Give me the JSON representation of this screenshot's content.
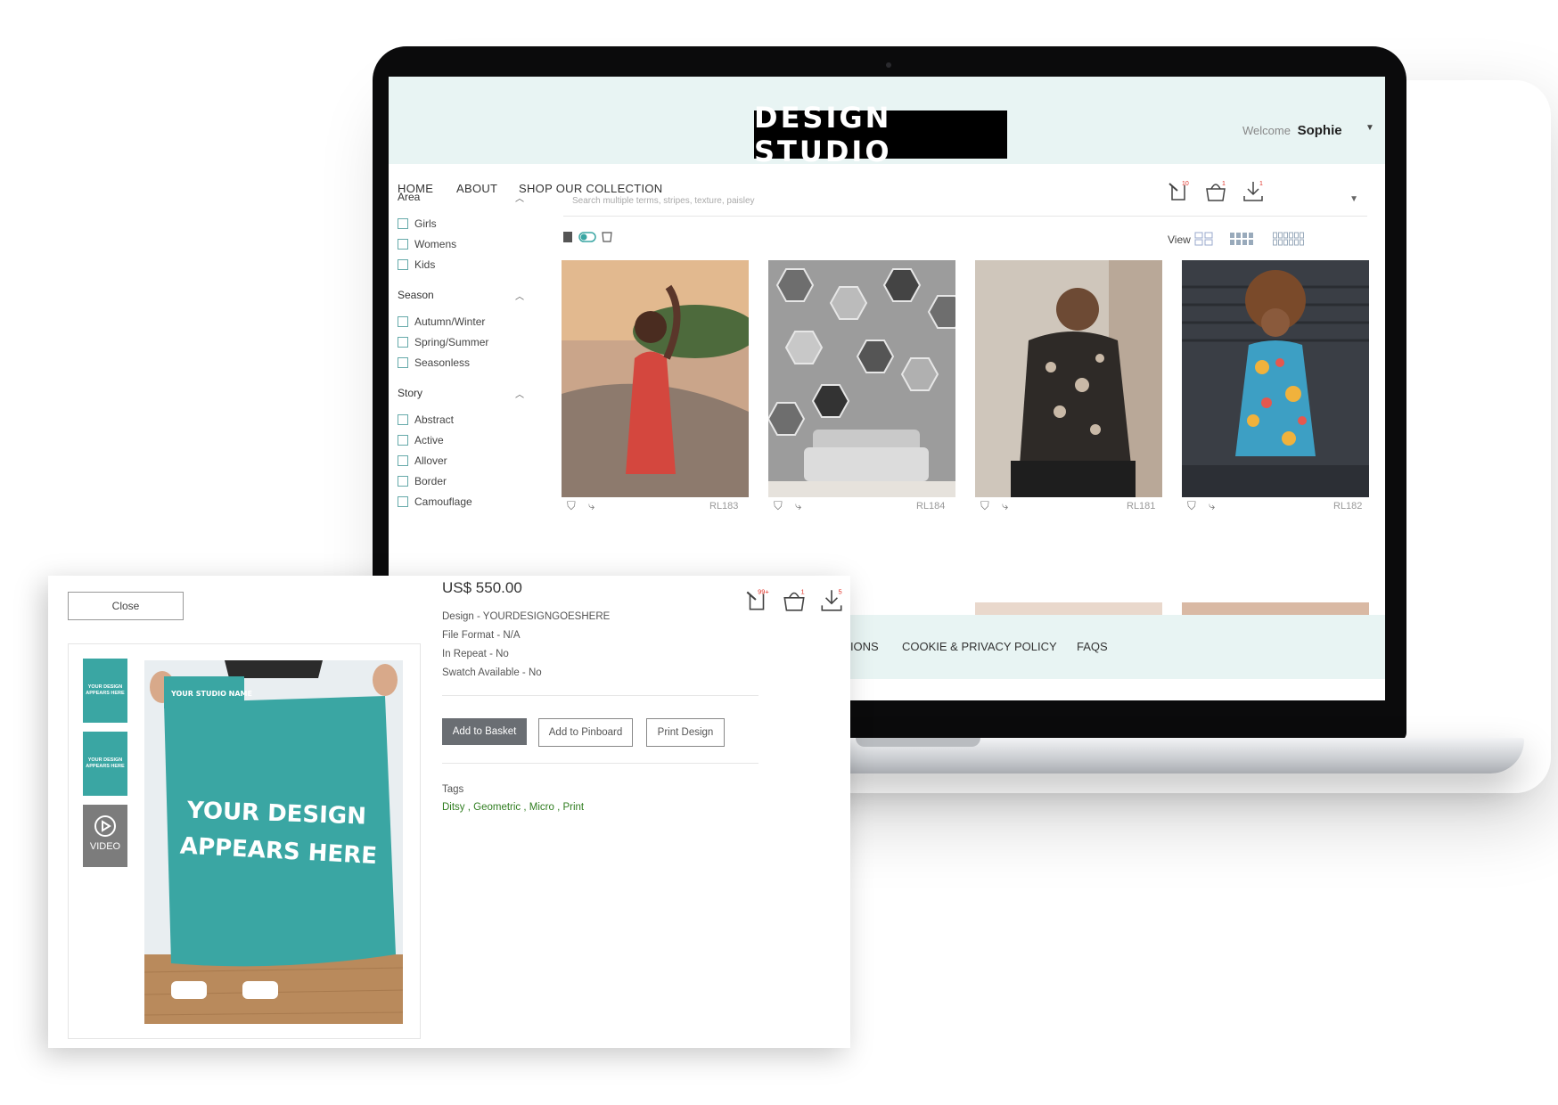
{
  "site": {
    "logo": "DESIGN STUDIO",
    "welcome_prefix": "Welcome",
    "user_name": "Sophie",
    "nav": [
      "HOME",
      "ABOUT",
      "SHOP OUR COLLECTION"
    ],
    "pinboard_badge": "10",
    "basket_badge": "1",
    "download_badge": "1",
    "search_placeholder": "Search multiple terms, stripes, texture, paisley",
    "view_label": "View",
    "filters": [
      {
        "title": "Area",
        "options": [
          "Girls",
          "Womens",
          "Kids"
        ]
      },
      {
        "title": "Season",
        "options": [
          "Autumn/Winter",
          "Spring/Summer",
          "Seasonless"
        ]
      },
      {
        "title": "Story",
        "options": [
          "Abstract",
          "Active",
          "Allover",
          "Border",
          "Camouflage"
        ]
      }
    ],
    "products": [
      {
        "code": "RL183"
      },
      {
        "code": "RL184"
      },
      {
        "code": "RL181"
      },
      {
        "code": "RL182"
      }
    ],
    "footer": [
      "TIONS",
      "COOKIE & PRIVACY POLICY",
      "FAQS"
    ]
  },
  "popup": {
    "close_label": "Close",
    "pinboard_badge": "99+",
    "basket_badge": "1",
    "download_badge": "5",
    "thumb_text": "YOUR DESIGN APPEARS HERE",
    "video_label": "VIDEO",
    "mockup_studio": "YOUR STUDIO NAME",
    "mockup_line1": "YOUR DESIGN",
    "mockup_line2": "APPEARS HERE",
    "price": "US$ 550.00",
    "specs": [
      "Design - YOURDESIGNGOESHERE",
      "File Format - N/A",
      "In Repeat -  No",
      "Swatch Available - No"
    ],
    "buttons": {
      "basket": "Add to Basket",
      "pinboard": "Add to Pinboard",
      "print": "Print Design"
    },
    "tags_label": "Tags",
    "tags": "Ditsy , Geometric , Micro , Print"
  },
  "colors": {
    "accent_teal": "#3aa6a3",
    "header_bg": "#e8f4f3",
    "tag_green": "#2f7d1f",
    "badge_red": "#e0342a"
  }
}
